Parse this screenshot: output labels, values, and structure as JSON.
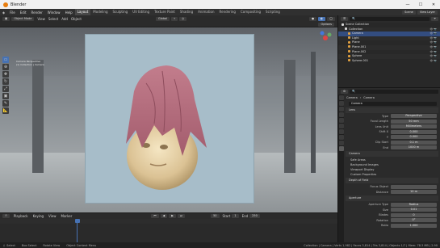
{
  "titlebar": {
    "title": "Blender",
    "minimize": "—",
    "maximize": "☐",
    "close": "✕"
  },
  "menubar": {
    "menus": [
      "File",
      "Edit",
      "Render",
      "Window",
      "Help"
    ],
    "tabs": [
      "Layout",
      "Modeling",
      "Sculpting",
      "UV Editing",
      "Texture Paint",
      "Shading",
      "Animation",
      "Rendering",
      "Compositing",
      "Scripting"
    ],
    "scene": "Scene",
    "view_layer": "View Layer"
  },
  "viewport_header": {
    "editor": "Object Mode",
    "menus": [
      "View",
      "Select",
      "Add",
      "Object"
    ],
    "orientation": "Global",
    "row2": [
      "Options"
    ]
  },
  "viewport_text": [
    "Camera Perspective",
    "(1) Collection | Camera"
  ],
  "outliner": {
    "title": "Scene Collection",
    "rows": [
      {
        "name": "Scene Collection",
        "color": "#d8d8d8",
        "sel": false
      },
      {
        "name": "Collection",
        "color": "#d8d8d8",
        "sel": false
      },
      {
        "name": "Camera",
        "color": "#e0a040",
        "sel": true
      },
      {
        "name": "Light",
        "color": "#e0a040",
        "sel": false
      },
      {
        "name": "Plane",
        "color": "#e0a040",
        "sel": false
      },
      {
        "name": "Plane.001",
        "color": "#e0a040",
        "sel": false
      },
      {
        "name": "Plane.002",
        "color": "#e0a040",
        "sel": false
      },
      {
        "name": "Sphere",
        "color": "#e0a040",
        "sel": false
      },
      {
        "name": "Sphere.001",
        "color": "#e0a040",
        "sel": false
      }
    ]
  },
  "properties": {
    "header_obj": "Camera",
    "header_data": "Camera",
    "name_field": "Camera",
    "lens_section": "Lens",
    "fields": [
      {
        "label": "Type",
        "value": "Perspective"
      },
      {
        "label": "Focal Length",
        "value": "50 mm"
      },
      {
        "label": "Lens Unit",
        "value": "Millimeters"
      },
      {
        "label": "Shift X",
        "value": "0.000"
      },
      {
        "label": "Y",
        "value": "0.000"
      },
      {
        "label": "Clip Start",
        "value": "0.1 m"
      },
      {
        "label": "End",
        "value": "1000 m"
      }
    ],
    "sections": [
      "Camera",
      "Safe Areas",
      "Background Images",
      "Viewport Display",
      "Custom Properties",
      "Depth of Field"
    ],
    "dof_fields": [
      {
        "label": "Focus Object",
        "value": ""
      },
      {
        "label": "Distance",
        "value": "10 m"
      }
    ],
    "aperture_section": "Aperture",
    "aperture_fields": [
      {
        "label": "Aperture Type",
        "value": "Radius"
      },
      {
        "label": "Size",
        "value": "0.01"
      },
      {
        "label": "Blades",
        "value": "0"
      },
      {
        "label": "Rotation",
        "value": "0°"
      },
      {
        "label": "Ratio",
        "value": "1.000"
      }
    ]
  },
  "timeline": {
    "menus": [
      "Playback",
      "Keying",
      "View",
      "Marker"
    ],
    "start_label": "Start",
    "start": "1",
    "end_label": "End",
    "end": "250",
    "current": "50"
  },
  "statusbar": {
    "left": "Select",
    "mid1": "Box Select",
    "mid2": "Rotate View",
    "mid3": "Object Context Menu",
    "right": "Collection | Camera | Verts 1,982 | Faces 3,814 | Tris 3,814 | Objects 1/7 | Mem: 78.3 MB | 2.90"
  },
  "colors": {
    "accent": "#4772b3",
    "selected": "#334d80",
    "frame_bg": "#a7bdc9"
  }
}
